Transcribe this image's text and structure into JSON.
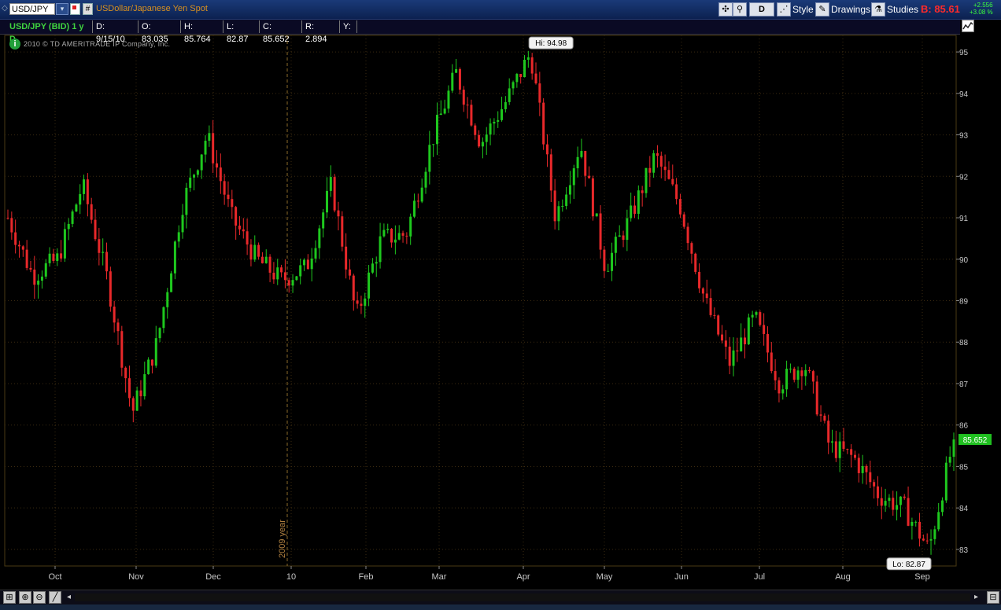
{
  "toolbar": {
    "symbol": "USD/JPY",
    "description": "USDollar/Japanese Yen Spot",
    "hash": "#",
    "timeframe_button": "D",
    "style_label": "Style",
    "drawings_label": "Drawings",
    "studies_label": "Studies",
    "bid": "B: 85.61",
    "change_abs": "+2.556",
    "change_pct": "+3.08 %"
  },
  "infobar": {
    "title": "USD/JPY (BID) 1 y D",
    "date": "D: 9/15/10",
    "open": "O: 83.035",
    "high": "H: 85.764",
    "low": "L: 82.87",
    "close": "C: 85.652",
    "range": "R: 2.894",
    "y": "Y:"
  },
  "copyright": "2010 © TD AMERITRADE IP Company, Inc.",
  "chart_data": {
    "type": "candlestick",
    "symbol": "USD/JPY",
    "ylim": [
      82.6,
      95.4
    ],
    "y_ticks": [
      83,
      84,
      85,
      86,
      87,
      88,
      89,
      90,
      91,
      92,
      93,
      94,
      95
    ],
    "x_ticks": [
      "Oct",
      "Nov",
      "Dec",
      "10",
      "Feb",
      "Mar",
      "Apr",
      "May",
      "Jun",
      "Jul",
      "Aug",
      "Sep"
    ],
    "year_marker": "2009 year",
    "hi_label": "Hi: 94.98",
    "lo_label": "Lo: 82.87",
    "last_price": "85.652",
    "close_path": [
      {
        "month": "Sep",
        "price": 91.0
      },
      {
        "month": "Oct",
        "price": 89.6
      },
      {
        "month": "Nov",
        "price": 90.0
      },
      {
        "month": "Nov",
        "price": 91.8
      },
      {
        "month": "Nov",
        "price": 89.5
      },
      {
        "month": "Dec",
        "price": 86.3
      },
      {
        "month": "Dec",
        "price": 88.0
      },
      {
        "month": "Dec",
        "price": 91.3
      },
      {
        "month": "10",
        "price": 93.0
      },
      {
        "month": "10",
        "price": 91.0
      },
      {
        "month": "10",
        "price": 90.0
      },
      {
        "month": "Feb",
        "price": 89.5
      },
      {
        "month": "Feb",
        "price": 89.8
      },
      {
        "month": "Feb",
        "price": 91.8
      },
      {
        "month": "Mar",
        "price": 88.6
      },
      {
        "month": "Mar",
        "price": 90.5
      },
      {
        "month": "Mar",
        "price": 90.6
      },
      {
        "month": "Apr",
        "price": 92.8
      },
      {
        "month": "Apr",
        "price": 94.5
      },
      {
        "month": "Apr",
        "price": 92.8
      },
      {
        "month": "Apr",
        "price": 93.8
      },
      {
        "month": "May",
        "price": 94.98
      },
      {
        "month": "May",
        "price": 91.0
      },
      {
        "month": "May",
        "price": 92.8
      },
      {
        "month": "May",
        "price": 89.8
      },
      {
        "month": "Jun",
        "price": 91.0
      },
      {
        "month": "Jun",
        "price": 92.5
      },
      {
        "month": "Jun",
        "price": 91.3
      },
      {
        "month": "Jul",
        "price": 89.0
      },
      {
        "month": "Jul",
        "price": 87.5
      },
      {
        "month": "Jul",
        "price": 88.6
      },
      {
        "month": "Aug",
        "price": 87.0
      },
      {
        "month": "Aug",
        "price": 87.5
      },
      {
        "month": "Aug",
        "price": 85.5
      },
      {
        "month": "Aug",
        "price": 85.2
      },
      {
        "month": "Sep",
        "price": 84.3
      },
      {
        "month": "Sep",
        "price": 84.0
      },
      {
        "month": "Sep",
        "price": 83.0
      },
      {
        "month": "Sep",
        "price": 85.652
      }
    ],
    "colors": {
      "up": "#1ec81e",
      "down": "#e8282a",
      "grid": "#3a2a10",
      "axis_text": "#c8c8c8",
      "last_box": "#20c020"
    }
  }
}
